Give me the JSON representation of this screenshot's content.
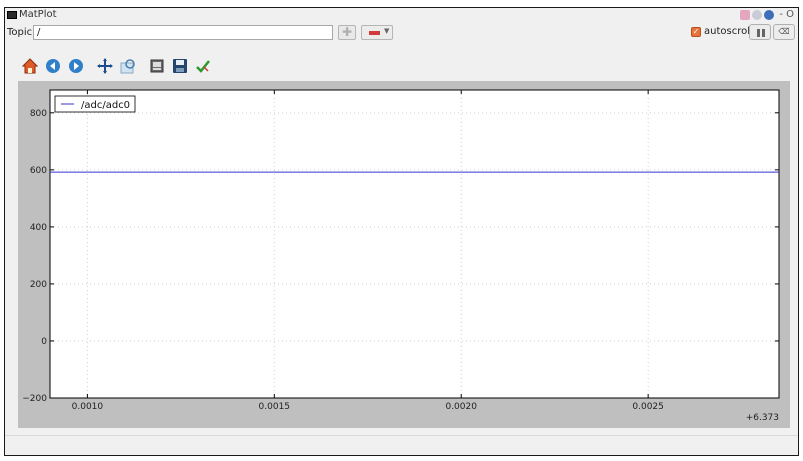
{
  "window": {
    "title": "MatPlot",
    "extra_label": "- O"
  },
  "topic": {
    "label": "Topic",
    "value": "/"
  },
  "controls": {
    "autoscroll_label": "autoscroll",
    "autoscroll_checked": true
  },
  "toolbar": {
    "icons": [
      "home-icon",
      "back-icon",
      "forward-icon",
      "pan-icon",
      "zoom-icon",
      "configure-icon",
      "save-icon",
      "edit-check-icon"
    ]
  },
  "colors": {
    "line": "#3333cc",
    "plot_background": "#bfbfbf",
    "axes_background": "#ffffff",
    "grid": "#d0d0d0"
  },
  "chart_data": {
    "type": "line",
    "series": [
      {
        "name": "/adc/adc0",
        "x": [
          0.0009,
          0.00285
        ],
        "y": [
          592,
          592
        ]
      }
    ],
    "xlim": [
      0.0009,
      0.00285
    ],
    "ylim": [
      -200,
      880
    ],
    "xticks": [
      0.001,
      0.0015,
      0.002,
      0.0025
    ],
    "xtick_labels": [
      "0.0010",
      "0.0015",
      "0.0020",
      "0.0025"
    ],
    "yticks": [
      -200,
      0,
      200,
      400,
      600,
      800
    ],
    "ytick_labels": [
      "−200",
      "0",
      "200",
      "400",
      "600",
      "800"
    ],
    "x_offset_label": "+6.373",
    "grid": true,
    "legend_position": "top-left"
  }
}
